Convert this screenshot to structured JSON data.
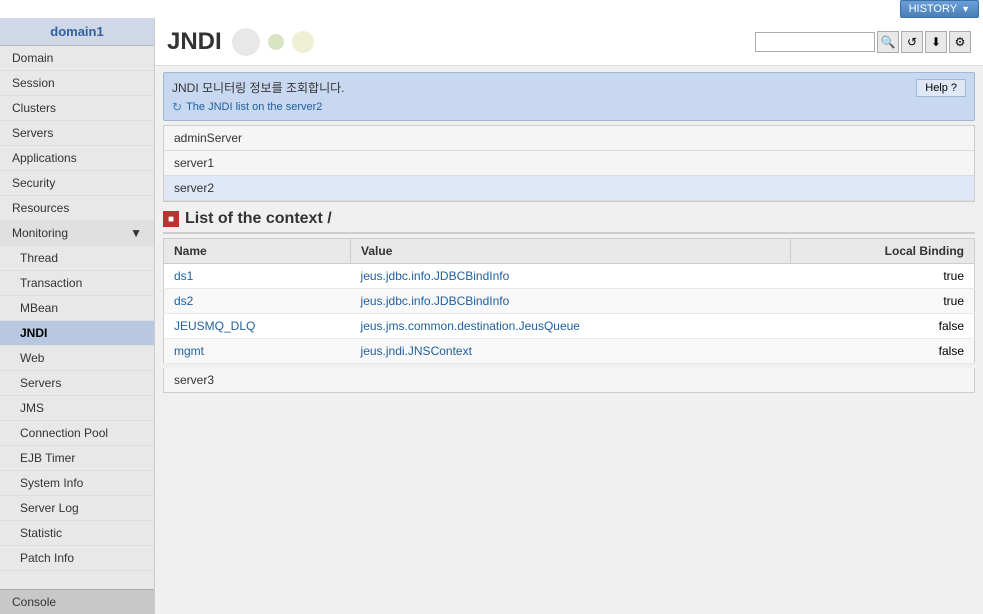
{
  "topbar": {
    "history_label": "HISTORY"
  },
  "sidebar": {
    "domain_label": "domain1",
    "items": [
      {
        "label": "Domain",
        "id": "domain"
      },
      {
        "label": "Session",
        "id": "session"
      },
      {
        "label": "Clusters",
        "id": "clusters"
      },
      {
        "label": "Servers",
        "id": "servers"
      },
      {
        "label": "Applications",
        "id": "applications"
      },
      {
        "label": "Security",
        "id": "security"
      },
      {
        "label": "Resources",
        "id": "resources"
      }
    ],
    "monitoring_label": "Monitoring",
    "monitoring_items": [
      {
        "label": "Thread",
        "id": "thread"
      },
      {
        "label": "Transaction",
        "id": "transaction"
      },
      {
        "label": "MBean",
        "id": "mbean"
      },
      {
        "label": "JNDI",
        "id": "jndi"
      },
      {
        "label": "Web",
        "id": "web"
      },
      {
        "label": "Servers",
        "id": "servers-mon"
      },
      {
        "label": "JMS",
        "id": "jms"
      },
      {
        "label": "Connection Pool",
        "id": "connection-pool"
      },
      {
        "label": "EJB Timer",
        "id": "ejb-timer"
      },
      {
        "label": "System Info",
        "id": "system-info"
      },
      {
        "label": "Server Log",
        "id": "server-log"
      },
      {
        "label": "Statistic",
        "id": "statistic"
      },
      {
        "label": "Patch Info",
        "id": "patch-info"
      }
    ],
    "console_label": "Console"
  },
  "header": {
    "title": "JNDI",
    "search_placeholder": ""
  },
  "infobar": {
    "title": "JNDI 모니터링 정보를 조회합니다.",
    "message": "The JNDI list on the server2",
    "help_label": "Help",
    "help_icon": "?"
  },
  "servers": [
    {
      "label": "adminServer"
    },
    {
      "label": "server1"
    },
    {
      "label": "server2"
    }
  ],
  "context": {
    "title": "List of the context /",
    "icon_label": "■"
  },
  "table": {
    "headers": [
      "Name",
      "Value",
      "Local Binding"
    ],
    "rows": [
      {
        "name": "ds1",
        "value": "jeus.jdbc.info.JDBCBindInfo",
        "binding": "true"
      },
      {
        "name": "ds2",
        "value": "jeus.jdbc.info.JDBCBindInfo",
        "binding": "true"
      },
      {
        "name": "JEUSMQ_DLQ",
        "value": "jeus.jms.common.destination.JeusQueue",
        "binding": "false"
      },
      {
        "name": "mgmt",
        "value": "jeus.jndi.JNSContext",
        "binding": "false"
      }
    ]
  },
  "server3": {
    "label": "server3"
  }
}
